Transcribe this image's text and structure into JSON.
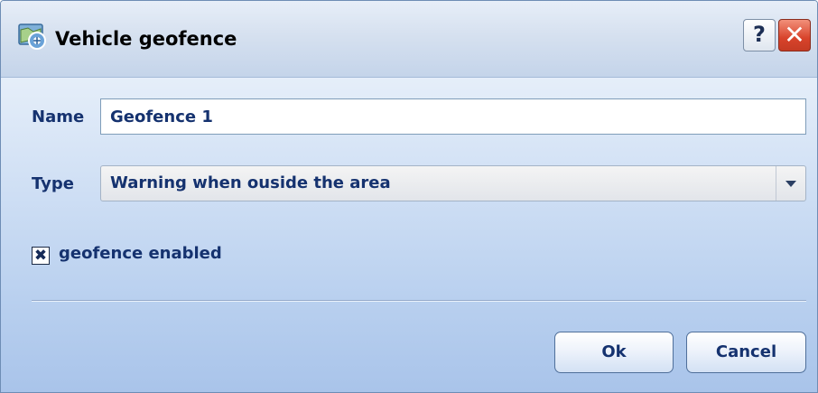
{
  "window": {
    "title": "Vehicle geofence",
    "title_icon": "map-globe-icon",
    "help_label": "?",
    "close_label": "✕"
  },
  "form": {
    "name_label": "Name",
    "name_value": "Geofence 1",
    "type_label": "Type",
    "type_selected": "Warning when ouside the area",
    "enabled_checked": true,
    "enabled_mark": "✖",
    "enabled_label": "geofence enabled"
  },
  "buttons": {
    "ok_label": "Ok",
    "cancel_label": "Cancel"
  },
  "colors": {
    "label_text": "#15326f",
    "close_button": "#d8432b",
    "dialog_gradient_bottom": "#a9c4ea"
  }
}
